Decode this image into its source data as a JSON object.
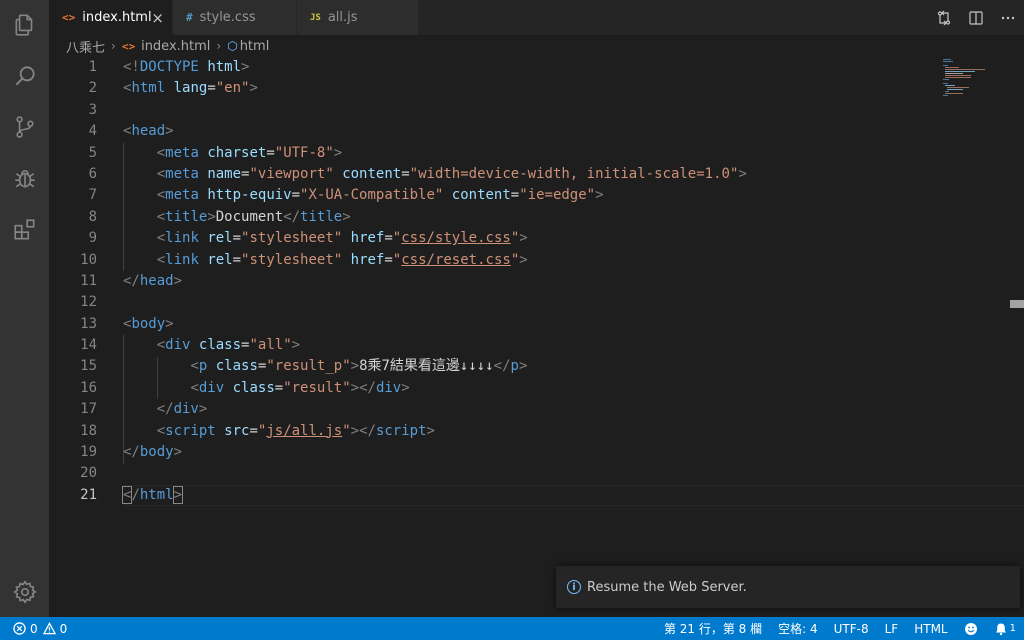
{
  "tabs": [
    {
      "icon": "<>",
      "label": "index.html",
      "active": true,
      "close": "×"
    },
    {
      "icon": "#",
      "label": "style.css",
      "active": false
    },
    {
      "icon": "JS",
      "label": "all.js",
      "active": false
    }
  ],
  "breadcrumb": {
    "folder": "八乘七",
    "sep": "›",
    "file_icon": "<>",
    "file": "index.html",
    "symbol_icon": "⬡",
    "symbol": "html"
  },
  "gutter": [
    "1",
    "2",
    "3",
    "4",
    "5",
    "6",
    "7",
    "8",
    "9",
    "10",
    "11",
    "12",
    "13",
    "14",
    "15",
    "16",
    "17",
    "18",
    "19",
    "20",
    "21"
  ],
  "code": {
    "l14_text": "8乘7結果看這邊↓↓↓↓"
  },
  "notification": {
    "icon": "i",
    "message": "Resume the Web Server."
  },
  "status": {
    "errors": "0",
    "warnings": "0",
    "position": "第 21 行，第 8 欄",
    "spaces": "空格: 4",
    "encoding": "UTF-8",
    "eol": "LF",
    "language": "HTML"
  },
  "colors": {
    "accent": "#007acc",
    "tag": "#569cd6",
    "attr": "#9cdcfe",
    "string": "#ce9178"
  }
}
